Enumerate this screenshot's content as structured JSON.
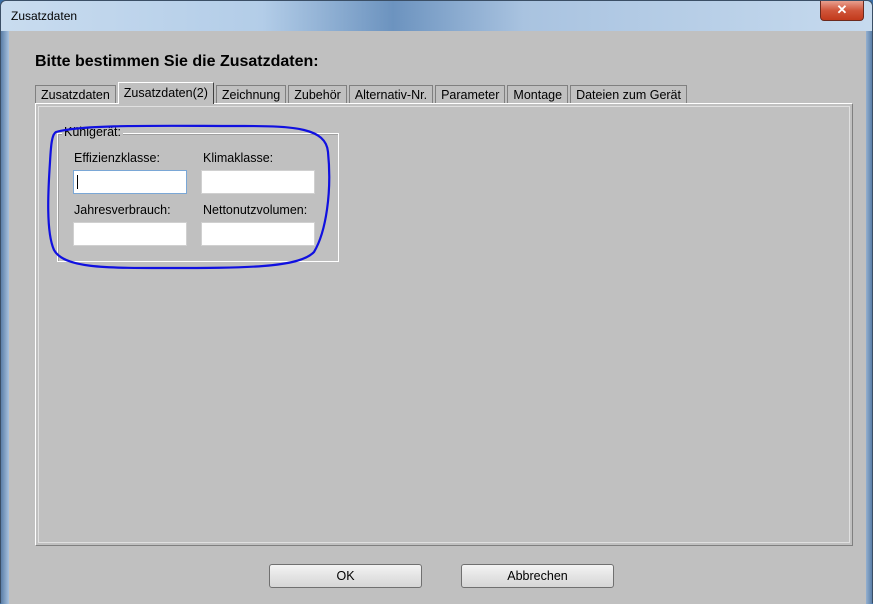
{
  "window": {
    "title": "Zusatzdaten",
    "close_glyph": "✕"
  },
  "heading": "Bitte bestimmen Sie die Zusatzdaten:",
  "tabs": [
    {
      "label": "Zusatzdaten"
    },
    {
      "label": "Zusatzdaten(2)",
      "active": true
    },
    {
      "label": "Zeichnung"
    },
    {
      "label": "Zubehör"
    },
    {
      "label": "Alternativ-Nr."
    },
    {
      "label": "Parameter"
    },
    {
      "label": "Montage"
    },
    {
      "label": "Dateien zum Gerät"
    }
  ],
  "group": {
    "label": "Kühlgerät:",
    "fields": [
      {
        "label": "Effizienzklasse:",
        "value": ""
      },
      {
        "label": "Klimaklasse:",
        "value": ""
      },
      {
        "label": "Jahresverbrauch:",
        "value": ""
      },
      {
        "label": "Nettonutzvolumen:",
        "value": ""
      }
    ]
  },
  "buttons": {
    "ok": "OK",
    "cancel": "Abbrechen"
  },
  "colors": {
    "annotation": "#1010e0",
    "dialog_bg": "#c0c0c0"
  }
}
